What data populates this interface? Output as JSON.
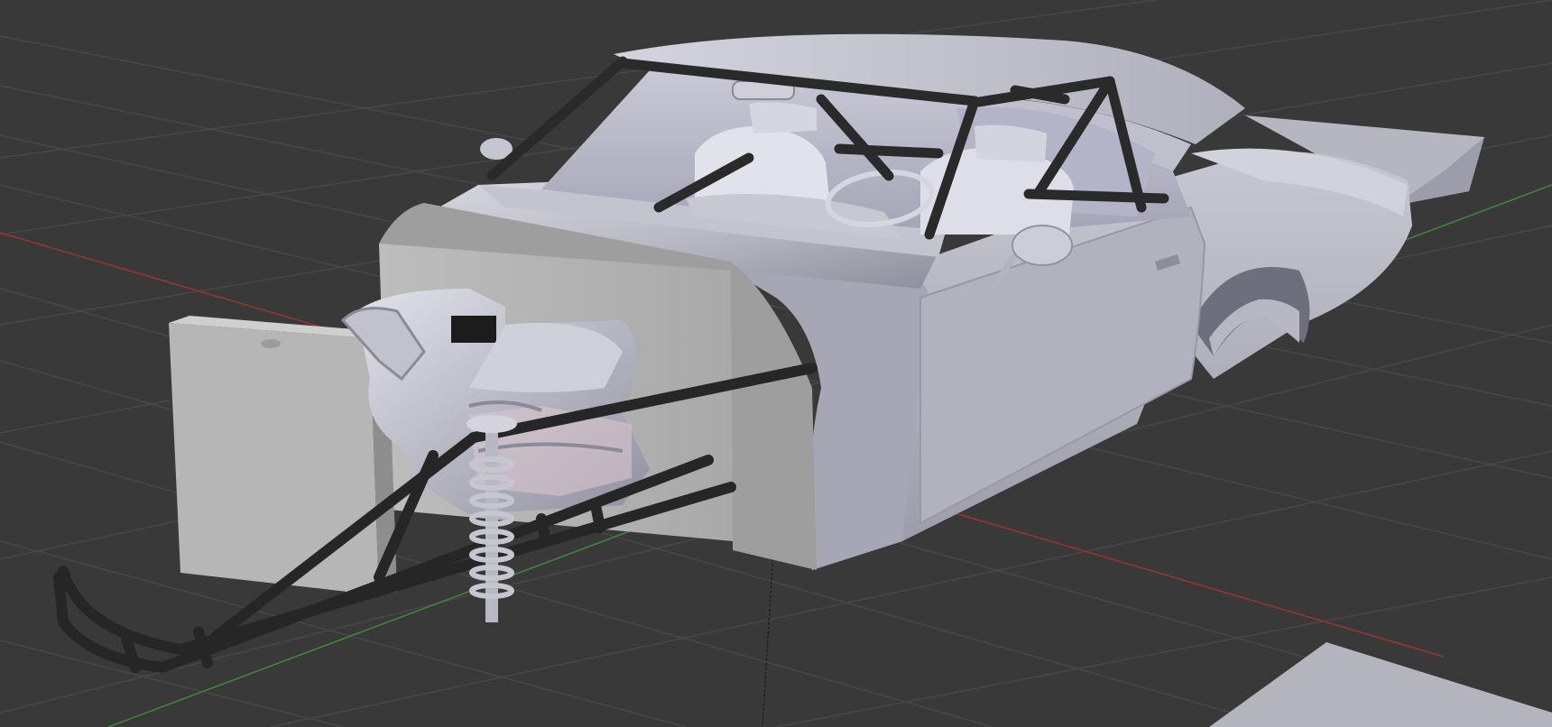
{
  "viewport": {
    "background_color": "#393939",
    "grid_color": "#4a4a4a",
    "x_axis_color": "#9a3434",
    "y_axis_color": "#3d8a3d",
    "z_axis_color": "#1a1a1a",
    "visible_text": "none"
  },
  "scene": {
    "object": "drag-car-body-with-roll-cage",
    "shading": "solid",
    "body_color": "#c2c2cc",
    "body_shadow_color": "#8a8a98",
    "body_highlight_color": "#e6e6ee",
    "cage_color": "#2a2a2a",
    "visible_parts": [
      "car-body-shell",
      "roof",
      "roll-cage",
      "seats",
      "steering-wheel",
      "rear-view-mirror",
      "side-mirror",
      "door-handle",
      "rear-wing",
      "firewall-panel",
      "engine-block",
      "radiator",
      "front-chassis-rails",
      "coilover-shock",
      "ground-plane-corner"
    ]
  }
}
